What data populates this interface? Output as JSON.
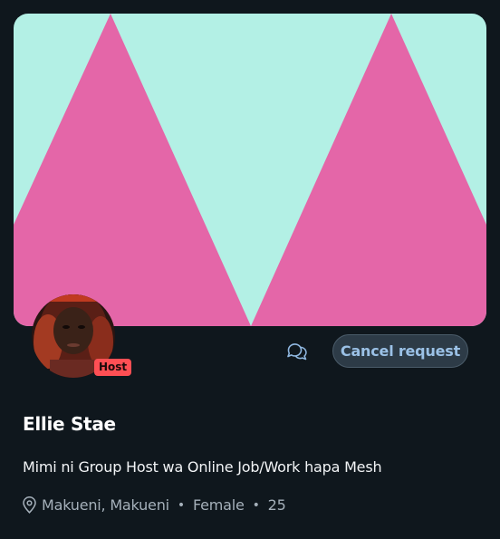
{
  "profile": {
    "name": "Ellie Stae",
    "bio": "Mimi ni Group Host wa Online Job/Work hapa Mesh",
    "badge": "Host",
    "location": "Makueni, Makueni",
    "gender": "Female",
    "age": "25"
  },
  "actions": {
    "cancel_label": "Cancel request"
  },
  "icons": {
    "chat": "chat-bubbles-icon",
    "location": "location-pin-icon"
  },
  "colors": {
    "background": "#0f171d",
    "banner_mint": "#b3f0e5",
    "banner_pink": "#e466a8",
    "badge": "#ff4f54",
    "button_text": "#9bc1e6"
  }
}
